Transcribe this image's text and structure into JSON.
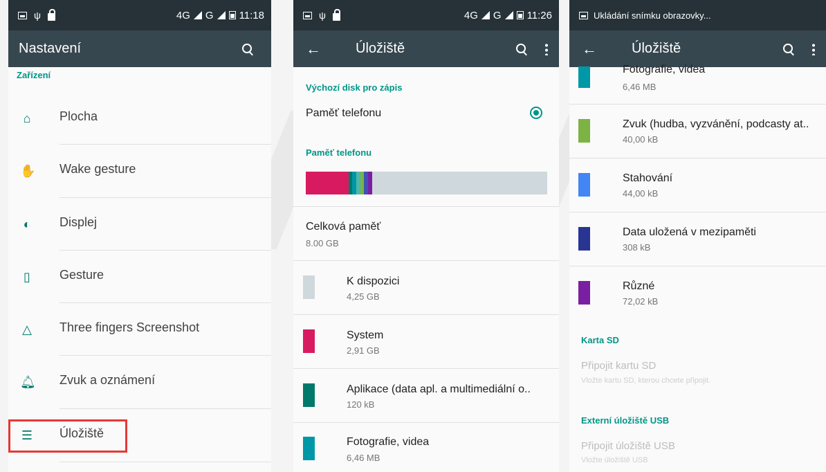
{
  "status_bar": {
    "network": "4G",
    "network_sup": "4G",
    "carrier_g": "G",
    "time1": "11:18",
    "time2": "11:26",
    "notif3": "Ukládání snímku obrazovky..."
  },
  "screen1": {
    "title": "Nastavení",
    "section": "Zařízení",
    "items": [
      {
        "label": "Plocha",
        "icon": "home-icon"
      },
      {
        "label": "Wake gesture",
        "icon": "hand-icon"
      },
      {
        "label": "Displej",
        "icon": "brightness-icon"
      },
      {
        "label": "Gesture",
        "icon": "phone-icon"
      },
      {
        "label": "Three fingers Screenshot",
        "icon": "triangle-icon"
      },
      {
        "label": "Zvuk a oznámení",
        "icon": "bell-icon"
      },
      {
        "label": "Úložiště",
        "icon": "storage-icon"
      }
    ]
  },
  "screen2": {
    "title": "Úložiště",
    "default_disk_section": "Výchozí disk pro zápis",
    "default_disk_value": "Paměť telefonu",
    "phone_memory_section": "Paměť telefonu",
    "total_label": "Celková paměť",
    "total_value": "8.00 GB",
    "rows": [
      {
        "title": "K dispozici",
        "value": "4,25 GB",
        "color": "#cfd8dc"
      },
      {
        "title": "System",
        "value": "2,91 GB",
        "color": "#d81b60"
      },
      {
        "title": "Aplikace (data apl. a multimediální o..",
        "value": "120 kB",
        "color": "#00796b"
      },
      {
        "title": "Fotografie, videa",
        "value": "6,46 MB",
        "color": "#0097a7"
      }
    ],
    "bar_colors": [
      "#d81b60",
      "#00796b",
      "#0097a7",
      "#7cb342",
      "#3f51b5",
      "#7b1fa2"
    ]
  },
  "screen3": {
    "title": "Úložiště",
    "rows": [
      {
        "title": "Fotografie, videa",
        "value": "6,46 MB",
        "color": "#0097a7"
      },
      {
        "title": "Zvuk (hudba, vyzvánění, podcasty at..",
        "value": "40,00 kB",
        "color": "#7cb342"
      },
      {
        "title": "Stahování",
        "value": "44,00 kB",
        "color": "#4285f4"
      },
      {
        "title": "Data uložená v mezipaměti",
        "value": "308 kB",
        "color": "#283593"
      },
      {
        "title": "Různé",
        "value": "72,02 kB",
        "color": "#7b1fa2"
      }
    ],
    "sd_section": "Karta SD",
    "sd_title": "Připojit kartu SD",
    "sd_sub": "Vložte kartu SD, kterou chcete připojit.",
    "usb_section": "Externí úložiště USB",
    "usb_title": "Připojit úložiště USB",
    "usb_sub": "Vložte úložiště USB"
  }
}
